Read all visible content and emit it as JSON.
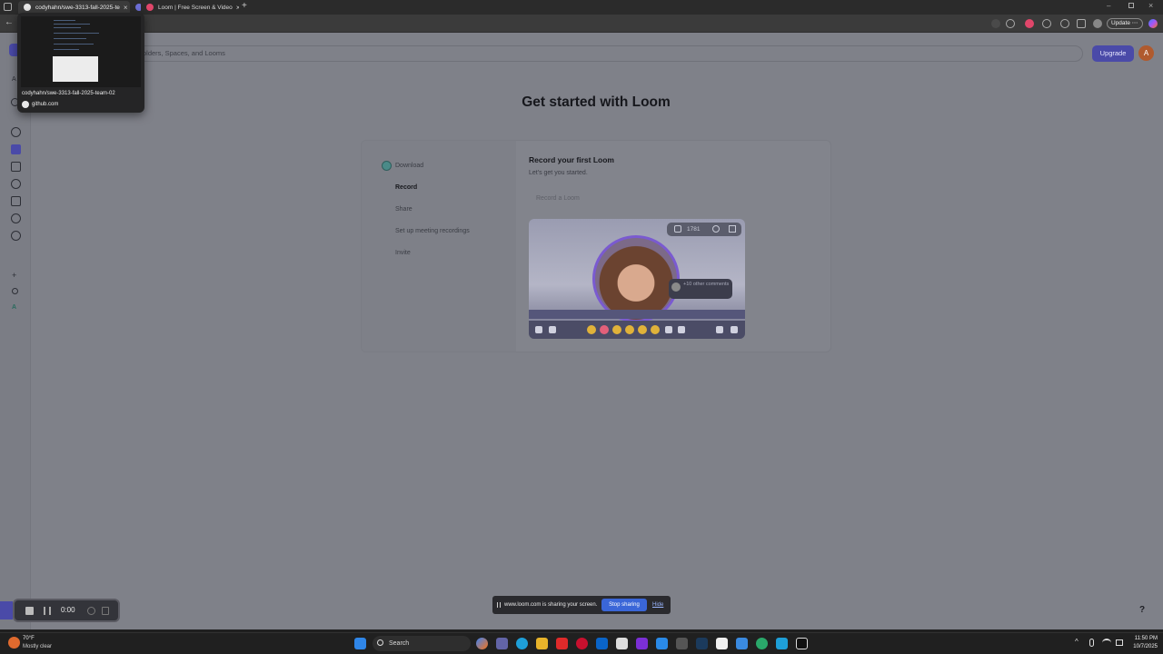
{
  "browser": {
    "tabs": [
      {
        "label": "codyhahn/swe-3313-fall-2025-te",
        "active": true
      },
      {
        "label": "",
        "active": false
      },
      {
        "label": "Loom | Free Screen & Video",
        "active": false
      }
    ],
    "update_label": "Update"
  },
  "tooltip": {
    "name": "codyhahn/swe-3313-fall-2025-team-02",
    "domain": "github.com"
  },
  "loom": {
    "search_placeholder": "olders, Spaces, and Looms",
    "upgrade_label": "Upgrade",
    "avatar_letter": "A",
    "heading": "Get started with Loom",
    "steps": [
      "Download",
      "Record",
      "Share",
      "Set up meeting recordings",
      "Invite"
    ],
    "active_step": "Record",
    "panel_title": "Record your first Loom",
    "panel_subtitle": "Let's get you started.",
    "record_button": "Record a Loom",
    "video": {
      "comment_count": "1781",
      "bubble_text": "+10 other comments"
    },
    "help_label": "?",
    "sidebar_letter": "A"
  },
  "share_notice": {
    "text": "www.loom.com is sharing your screen.",
    "stop_label": "Stop sharing",
    "hide_label": "Hide"
  },
  "recorder": {
    "time": "0:00"
  },
  "taskbar": {
    "weather_temp": "70°F",
    "weather_cond": "Mostly clear",
    "search_label": "Search",
    "time": "11:50 PM",
    "date": "10/7/2025"
  }
}
